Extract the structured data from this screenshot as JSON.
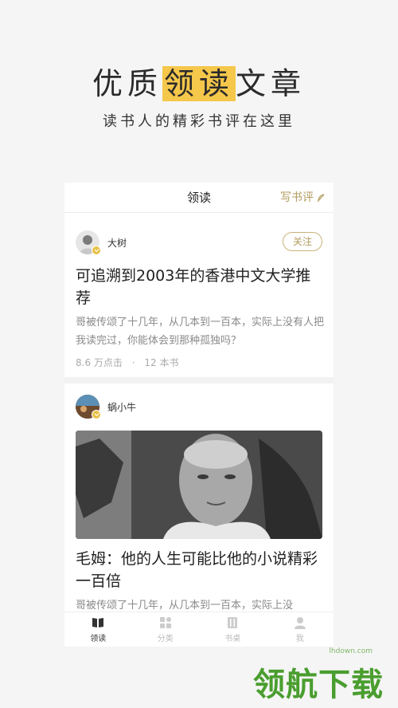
{
  "hero": {
    "title_pre": "优质",
    "title_highlight": "领读",
    "title_post": "文章",
    "subtitle": "读书人的精彩书评在这里"
  },
  "topbar": {
    "title": "领读",
    "write_label": "写书评"
  },
  "cards": [
    {
      "author": "大树",
      "follow_label": "关注",
      "title": "可追溯到2003年的香港中文大学推荐",
      "excerpt": "哥被传颂了十几年，从几本到一百本，实际上没有人把我读完过，你能体会到那种孤独吗？",
      "clicks": "8.6 万点击",
      "separator": "·",
      "books": "12 本书"
    },
    {
      "author": "蜗小牛",
      "title": "毛姆：他的人生可能比他的小说精彩一百倍",
      "excerpt": "哥被传颂了十几年，从几本到一百本，实际上没"
    }
  ],
  "tabbar": {
    "items": [
      {
        "label": "领读",
        "icon": "book-open-icon",
        "active": true
      },
      {
        "label": "分类",
        "icon": "grid-icon",
        "active": false
      },
      {
        "label": "书桌",
        "icon": "bookshelf-icon",
        "active": false
      },
      {
        "label": "我",
        "icon": "person-icon",
        "active": false
      }
    ]
  },
  "watermark": {
    "text": "领航下载",
    "url": "lhdown.com"
  },
  "colors": {
    "accent": "#f5c74a",
    "gold_text": "#b39b5e",
    "watermark": "#4a9e2f"
  }
}
